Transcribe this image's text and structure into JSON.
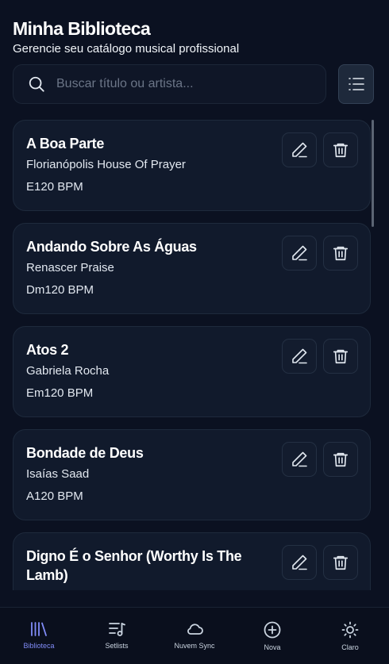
{
  "header": {
    "title": "Minha Biblioteca",
    "subtitle": "Gerencie seu catálogo musical profissional"
  },
  "search": {
    "placeholder": "Buscar título ou artista..."
  },
  "songs": [
    {
      "title": "A Boa Parte",
      "artist": "Florianópolis House Of Prayer",
      "meta": "E120 BPM"
    },
    {
      "title": "Andando Sobre As Águas",
      "artist": "Renascer Praise",
      "meta": "Dm120 BPM"
    },
    {
      "title": "Atos 2",
      "artist": "Gabriela Rocha",
      "meta": "Em120 BPM"
    },
    {
      "title": "Bondade de Deus",
      "artist": "Isaías Saad",
      "meta": "A120 BPM"
    },
    {
      "title": "Digno É o Senhor (Worthy Is The Lamb)",
      "artist": "",
      "meta": ""
    }
  ],
  "nav": {
    "items": [
      {
        "label": "Biblioteca",
        "icon": "library-icon",
        "active": true
      },
      {
        "label": "Setlists",
        "icon": "setlist-icon",
        "active": false
      },
      {
        "label": "Nuvem Sync",
        "icon": "cloud-icon",
        "active": false
      },
      {
        "label": "Nova",
        "icon": "plus-circle-icon",
        "active": false
      },
      {
        "label": "Claro",
        "icon": "sun-icon",
        "active": false
      }
    ]
  },
  "colors": {
    "accent": "#818cf8",
    "background": "#0b1121",
    "card": "#111a2c"
  }
}
